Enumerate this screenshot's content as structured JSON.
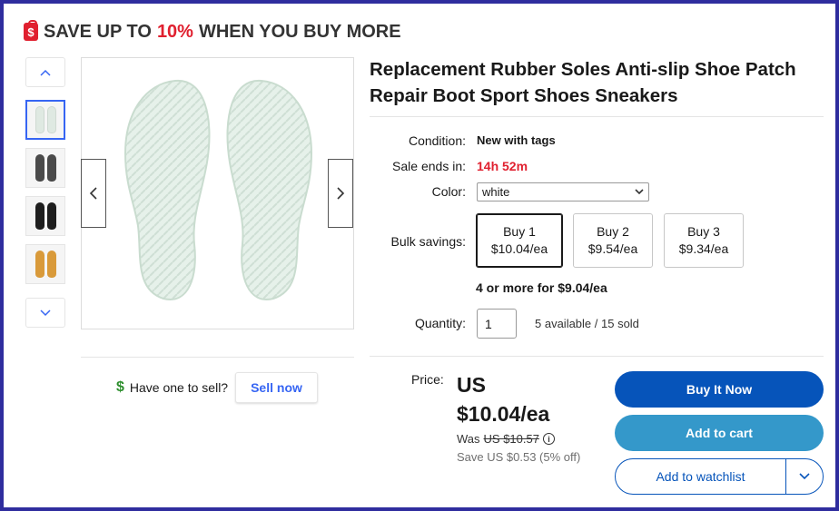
{
  "promo": {
    "prefix": "SAVE UP TO",
    "percent": "10%",
    "suffix": "WHEN YOU BUY MORE",
    "badge": "$"
  },
  "gallery": {
    "thumbnail_colors": [
      "#dfe9e2",
      "#3a3a3a",
      "#1e1e1e",
      "#d99a3a"
    ],
    "selected_index": 0
  },
  "sell": {
    "icon": "$",
    "prompt": "Have one to sell?",
    "button": "Sell now"
  },
  "item": {
    "title": "Replacement Rubber Soles Anti-slip Shoe Patch Repair Boot Sport Shoes Sneakers",
    "condition_label": "Condition:",
    "condition": "New with tags",
    "sale_label": "Sale ends in:",
    "sale_ends": "14h 52m",
    "color_label": "Color:",
    "color_selected": "white",
    "bulk_label": "Bulk savings:",
    "bulk_options": [
      {
        "qty": "Buy 1",
        "price": "$10.04/ea"
      },
      {
        "qty": "Buy 2",
        "price": "$9.54/ea"
      },
      {
        "qty": "Buy 3",
        "price": "$9.34/ea"
      }
    ],
    "bulk_note": "4 or more for $9.04/ea",
    "quantity_label": "Quantity:",
    "quantity": "1",
    "availability": "5 available / 15 sold",
    "price_label": "Price:",
    "price_line1": "US",
    "price_line2": "$10.04/ea",
    "was_label": "Was",
    "was_price": "US $10.57",
    "save_text": "Save US $0.53 (5% off)",
    "buy_now": "Buy It Now",
    "add_to_cart": "Add to cart",
    "add_to_watchlist": "Add to watchlist"
  },
  "colors": {
    "accent_blue": "#3665f3",
    "buy_button": "#0654ba",
    "cart_button": "#3498ca",
    "sale_red": "#e0202f"
  }
}
